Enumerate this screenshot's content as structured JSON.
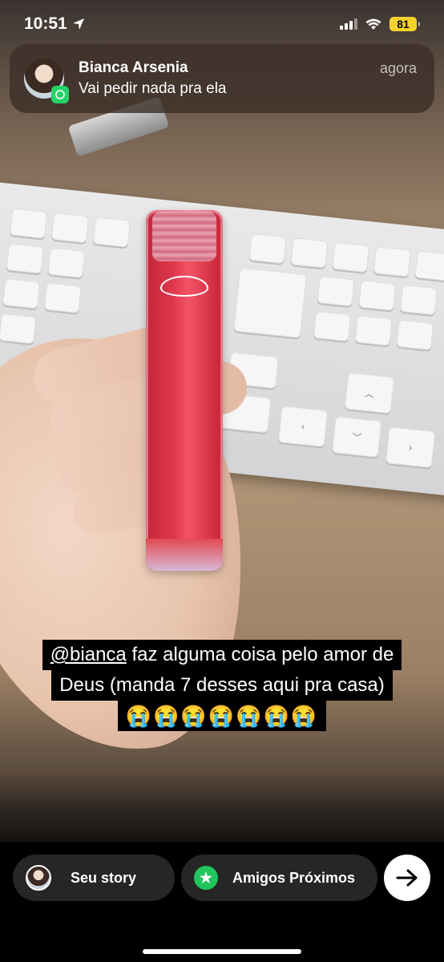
{
  "status_bar": {
    "time": "10:51",
    "battery": "81"
  },
  "notification": {
    "sender": "Bianca Arsenia",
    "message": "Vai pedir nada pra ela",
    "time": "agora",
    "app_icon": "whatsapp-icon"
  },
  "caption": {
    "mention": "@bianca",
    "line1_rest": " faz alguma coisa pelo amor de",
    "line2": "Deus (manda 7 desses aqui pra casa)",
    "emojis": "😭😭😭😭😭😭😭"
  },
  "bottom": {
    "your_story_label": "Seu story",
    "close_friends_label": "Amigos Próximos",
    "next_icon": "arrow-right-icon"
  },
  "colors": {
    "battery": "#f5d22c",
    "close_friends": "#21c55d",
    "whatsapp": "#25d366"
  }
}
